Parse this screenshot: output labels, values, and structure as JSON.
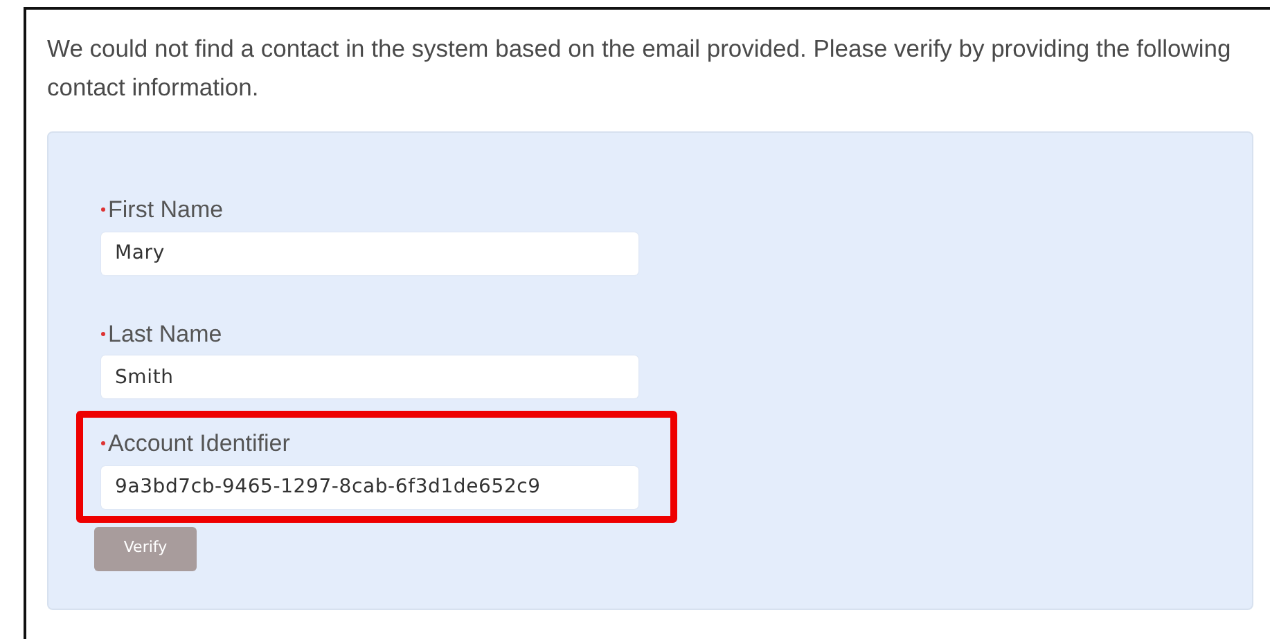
{
  "message": "We could not find a contact in the system based on the email provided. Please verify by providing the following contact information.",
  "fields": [
    {
      "label": "First Name",
      "required": true,
      "value": "Mary",
      "highlighted": false
    },
    {
      "label": "Last Name",
      "required": true,
      "value": "Smith",
      "highlighted": false
    },
    {
      "label": "Account Identifier",
      "required": true,
      "value": "9a3bd7cb-9465-1297-8cab-6f3d1de652c9",
      "highlighted": true
    }
  ],
  "button": {
    "label": "Verify",
    "disabled": true
  }
}
